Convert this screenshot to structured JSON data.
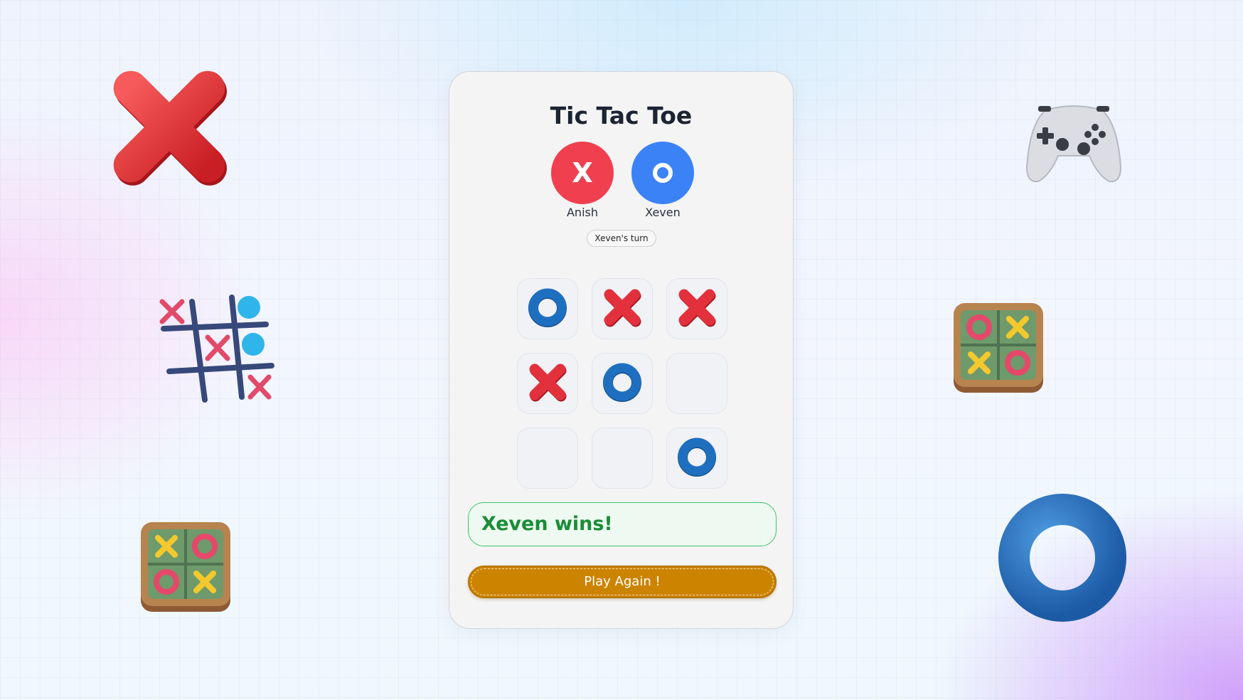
{
  "game": {
    "title": "Tic Tac Toe",
    "players": [
      {
        "name": "Anish",
        "symbol": "X",
        "color": "#f0404f"
      },
      {
        "name": "Xeven",
        "symbol": "O",
        "color": "#3b82f6"
      }
    ],
    "turn_text": "Xeven's turn",
    "board": [
      "O",
      "X",
      "X",
      "X",
      "O",
      "",
      "",
      "",
      "O"
    ],
    "result_text": "Xeven wins!",
    "play_again_label": "Play Again !"
  },
  "colors": {
    "x_mark": "#e2313d",
    "o_mark": "#1f6fc0",
    "win_green": "#1a8c37",
    "button": "#cc8400"
  },
  "decorations": [
    "big-red-x-icon",
    "gamepad-icon",
    "tictactoe-grid-icon",
    "board-icon",
    "board-icon",
    "blue-donut-icon"
  ]
}
